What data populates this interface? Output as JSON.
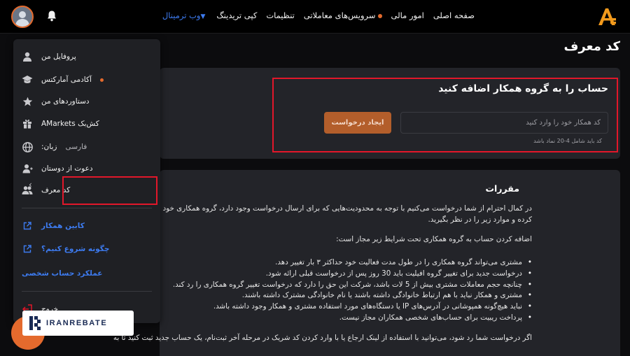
{
  "header": {
    "nav": [
      {
        "label": "صفحه اصلی"
      },
      {
        "label": "امور مالی"
      },
      {
        "label": "سرویس‌های معاملاتی"
      },
      {
        "label": "تنظیمات"
      },
      {
        "label": "کپی تریدینگ"
      },
      {
        "label": "وب ترمینال"
      }
    ]
  },
  "page": {
    "title": "کد معرف"
  },
  "referral": {
    "heading": "حساب را به گروه همکار اضافه کنید",
    "input_placeholder": "کد همکار خود را وارد کنید",
    "button": "ایجاد درخواست",
    "hint": "کد باید شامل 4-20 نماد باشد"
  },
  "rules": {
    "heading": "مقررات",
    "p1_line1": "در کمال احترام از شما درخواست می‌کنیم با توجه به محدودیت‌هایی که برای ارسال درخواست وجود دارد، گروه همکاری خود را به",
    "p1_line2": "کرده و موارد زیر را در نظر بگیرید.",
    "p2": "اضافه کردن حساب به گروه همکاری تحت شرایط زیر مجاز است:",
    "items": [
      "مشتری می‌تواند گروه همکاری را در طول مدت فعالیت خود حداکثر ۳ بار تغییر دهد.",
      "درخواست جدید برای تغییر گروه افیلیت باید 30 روز پس از درخواست قبلی ارائه شود.",
      "چنانچه حجم معاملات مشتری بیش از 5 لات باشد، شرکت این حق را دارد که درخواست تغییر گروه همکاری را رد کند.",
      "مشتری و همکار نباید با هم ارتباط خانوادگی داشته باشند یا نام خانوادگی مشترک داشته باشند.",
      "نباید هیچ‌گونه همپوشانی در آدرس‌های IP یا دستگاه‌های مورد استفاده مشتری و همکار وجود داشته باشد.",
      "پرداخت ریبیت برای حساب‌های شخصی همکاران مجاز نیست."
    ],
    "p3": "اگر درخواست شما رد شود، می‌توانید با استفاده از لینک ارجاع یا با وارد کردن کد شریک در مرحله آخر ثبت‌نام، یک حساب جدید ثبت کنید تا به"
  },
  "menu": {
    "profile": "پروفایل من",
    "academy": "آکادمی آمارکتس",
    "achievements": "دستاوردهای من",
    "cashback": "کش‌بک AMarkets",
    "language_label": "زبان:",
    "language_value": "فارسی",
    "invite": "دعوت از دوستان",
    "referral": "کد معرف",
    "partner_cabinet": "کابین همکار",
    "how_to_start": "چگونه شروع کنیم؟",
    "personal_account": "عملکرد حساب شخصی",
    "logout": "خروج"
  },
  "watermark": {
    "text": "IRANREBATE"
  },
  "colors": {
    "accent": "#e46a2d",
    "link": "#3d7bf0",
    "highlight": "#e2172a",
    "card": "#232429",
    "button": "#b35e2b"
  }
}
